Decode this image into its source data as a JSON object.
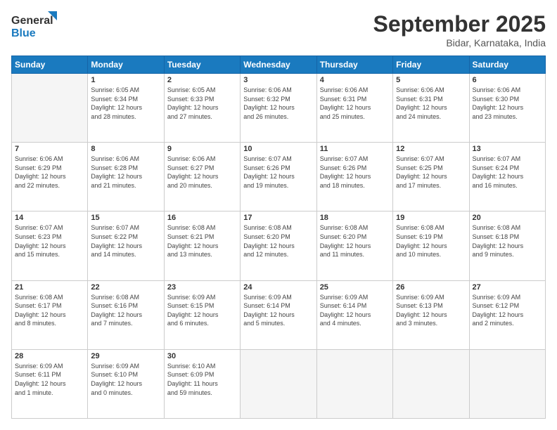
{
  "logo": {
    "line1": "General",
    "line2": "Blue"
  },
  "header": {
    "month": "September 2025",
    "location": "Bidar, Karnataka, India"
  },
  "weekdays": [
    "Sunday",
    "Monday",
    "Tuesday",
    "Wednesday",
    "Thursday",
    "Friday",
    "Saturday"
  ],
  "weeks": [
    [
      {
        "day": "",
        "info": ""
      },
      {
        "day": "1",
        "info": "Sunrise: 6:05 AM\nSunset: 6:34 PM\nDaylight: 12 hours\nand 28 minutes."
      },
      {
        "day": "2",
        "info": "Sunrise: 6:05 AM\nSunset: 6:33 PM\nDaylight: 12 hours\nand 27 minutes."
      },
      {
        "day": "3",
        "info": "Sunrise: 6:06 AM\nSunset: 6:32 PM\nDaylight: 12 hours\nand 26 minutes."
      },
      {
        "day": "4",
        "info": "Sunrise: 6:06 AM\nSunset: 6:31 PM\nDaylight: 12 hours\nand 25 minutes."
      },
      {
        "day": "5",
        "info": "Sunrise: 6:06 AM\nSunset: 6:31 PM\nDaylight: 12 hours\nand 24 minutes."
      },
      {
        "day": "6",
        "info": "Sunrise: 6:06 AM\nSunset: 6:30 PM\nDaylight: 12 hours\nand 23 minutes."
      }
    ],
    [
      {
        "day": "7",
        "info": "Sunrise: 6:06 AM\nSunset: 6:29 PM\nDaylight: 12 hours\nand 22 minutes."
      },
      {
        "day": "8",
        "info": "Sunrise: 6:06 AM\nSunset: 6:28 PM\nDaylight: 12 hours\nand 21 minutes."
      },
      {
        "day": "9",
        "info": "Sunrise: 6:06 AM\nSunset: 6:27 PM\nDaylight: 12 hours\nand 20 minutes."
      },
      {
        "day": "10",
        "info": "Sunrise: 6:07 AM\nSunset: 6:26 PM\nDaylight: 12 hours\nand 19 minutes."
      },
      {
        "day": "11",
        "info": "Sunrise: 6:07 AM\nSunset: 6:26 PM\nDaylight: 12 hours\nand 18 minutes."
      },
      {
        "day": "12",
        "info": "Sunrise: 6:07 AM\nSunset: 6:25 PM\nDaylight: 12 hours\nand 17 minutes."
      },
      {
        "day": "13",
        "info": "Sunrise: 6:07 AM\nSunset: 6:24 PM\nDaylight: 12 hours\nand 16 minutes."
      }
    ],
    [
      {
        "day": "14",
        "info": "Sunrise: 6:07 AM\nSunset: 6:23 PM\nDaylight: 12 hours\nand 15 minutes."
      },
      {
        "day": "15",
        "info": "Sunrise: 6:07 AM\nSunset: 6:22 PM\nDaylight: 12 hours\nand 14 minutes."
      },
      {
        "day": "16",
        "info": "Sunrise: 6:08 AM\nSunset: 6:21 PM\nDaylight: 12 hours\nand 13 minutes."
      },
      {
        "day": "17",
        "info": "Sunrise: 6:08 AM\nSunset: 6:20 PM\nDaylight: 12 hours\nand 12 minutes."
      },
      {
        "day": "18",
        "info": "Sunrise: 6:08 AM\nSunset: 6:20 PM\nDaylight: 12 hours\nand 11 minutes."
      },
      {
        "day": "19",
        "info": "Sunrise: 6:08 AM\nSunset: 6:19 PM\nDaylight: 12 hours\nand 10 minutes."
      },
      {
        "day": "20",
        "info": "Sunrise: 6:08 AM\nSunset: 6:18 PM\nDaylight: 12 hours\nand 9 minutes."
      }
    ],
    [
      {
        "day": "21",
        "info": "Sunrise: 6:08 AM\nSunset: 6:17 PM\nDaylight: 12 hours\nand 8 minutes."
      },
      {
        "day": "22",
        "info": "Sunrise: 6:08 AM\nSunset: 6:16 PM\nDaylight: 12 hours\nand 7 minutes."
      },
      {
        "day": "23",
        "info": "Sunrise: 6:09 AM\nSunset: 6:15 PM\nDaylight: 12 hours\nand 6 minutes."
      },
      {
        "day": "24",
        "info": "Sunrise: 6:09 AM\nSunset: 6:14 PM\nDaylight: 12 hours\nand 5 minutes."
      },
      {
        "day": "25",
        "info": "Sunrise: 6:09 AM\nSunset: 6:14 PM\nDaylight: 12 hours\nand 4 minutes."
      },
      {
        "day": "26",
        "info": "Sunrise: 6:09 AM\nSunset: 6:13 PM\nDaylight: 12 hours\nand 3 minutes."
      },
      {
        "day": "27",
        "info": "Sunrise: 6:09 AM\nSunset: 6:12 PM\nDaylight: 12 hours\nand 2 minutes."
      }
    ],
    [
      {
        "day": "28",
        "info": "Sunrise: 6:09 AM\nSunset: 6:11 PM\nDaylight: 12 hours\nand 1 minute."
      },
      {
        "day": "29",
        "info": "Sunrise: 6:09 AM\nSunset: 6:10 PM\nDaylight: 12 hours\nand 0 minutes."
      },
      {
        "day": "30",
        "info": "Sunrise: 6:10 AM\nSunset: 6:09 PM\nDaylight: 11 hours\nand 59 minutes."
      },
      {
        "day": "",
        "info": ""
      },
      {
        "day": "",
        "info": ""
      },
      {
        "day": "",
        "info": ""
      },
      {
        "day": "",
        "info": ""
      }
    ]
  ]
}
